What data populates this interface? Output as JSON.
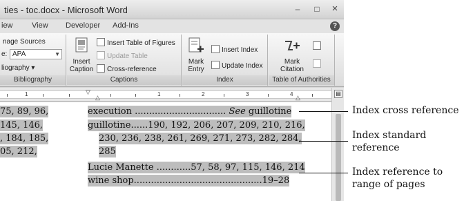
{
  "window": {
    "title": "ties - toc.docx - Microsoft Word",
    "controls": {
      "minimize": "–",
      "maximize": "□",
      "close": "×"
    }
  },
  "tabs": [
    "iew",
    "View",
    "Developer",
    "Add-Ins"
  ],
  "help_icon": "?",
  "ribbon": {
    "citations": {
      "manage_sources": "nage Sources",
      "style_label": "e:",
      "style_value": "APA",
      "bibliography": "liography ▾",
      "group_label": "Bibliography"
    },
    "captions": {
      "insert_caption": [
        "Insert",
        "Caption"
      ],
      "insert_table_of_figures": "Insert Table of Figures",
      "update_table": "Update Table",
      "cross_reference": "Cross-reference",
      "group_label": "Captions"
    },
    "index": {
      "mark_entry": [
        "Mark",
        "Entry"
      ],
      "insert_index": "Insert Index",
      "update_index": "Update Index",
      "group_label": "Index"
    },
    "authorities": {
      "mark_citation": [
        "Mark",
        "Citation"
      ],
      "group_label": "Table of Authorities"
    }
  },
  "ruler": {
    "numbers": [
      "1",
      "1",
      "2",
      "3",
      "4"
    ]
  },
  "document": {
    "left_column": [
      "75, 89, 96,",
      "145, 146,",
      ", 184, 185,",
      "05, 212,"
    ],
    "right_column": {
      "execution_entry": "execution ................................",
      "execution_see": "See",
      "execution_target": "guillotine",
      "guillotine_line1": "guillotine......190, 192, 206, 207, 209, 210, 216,",
      "guillotine_line2": "230, 236, 238, 261, 269, 271, 273, 282, 284,",
      "guillotine_line3": "285",
      "lucie_entry": "Lucie Manette ............57, 58, 97, 115, 146, 214",
      "wine_entry": "wine shop.............................................19–28"
    }
  },
  "annotations": {
    "cross_reference": "Index cross reference",
    "standard_line1": "Index standard",
    "standard_line2": "reference",
    "range_line1": "Index reference to",
    "range_line2": "range of pages"
  }
}
